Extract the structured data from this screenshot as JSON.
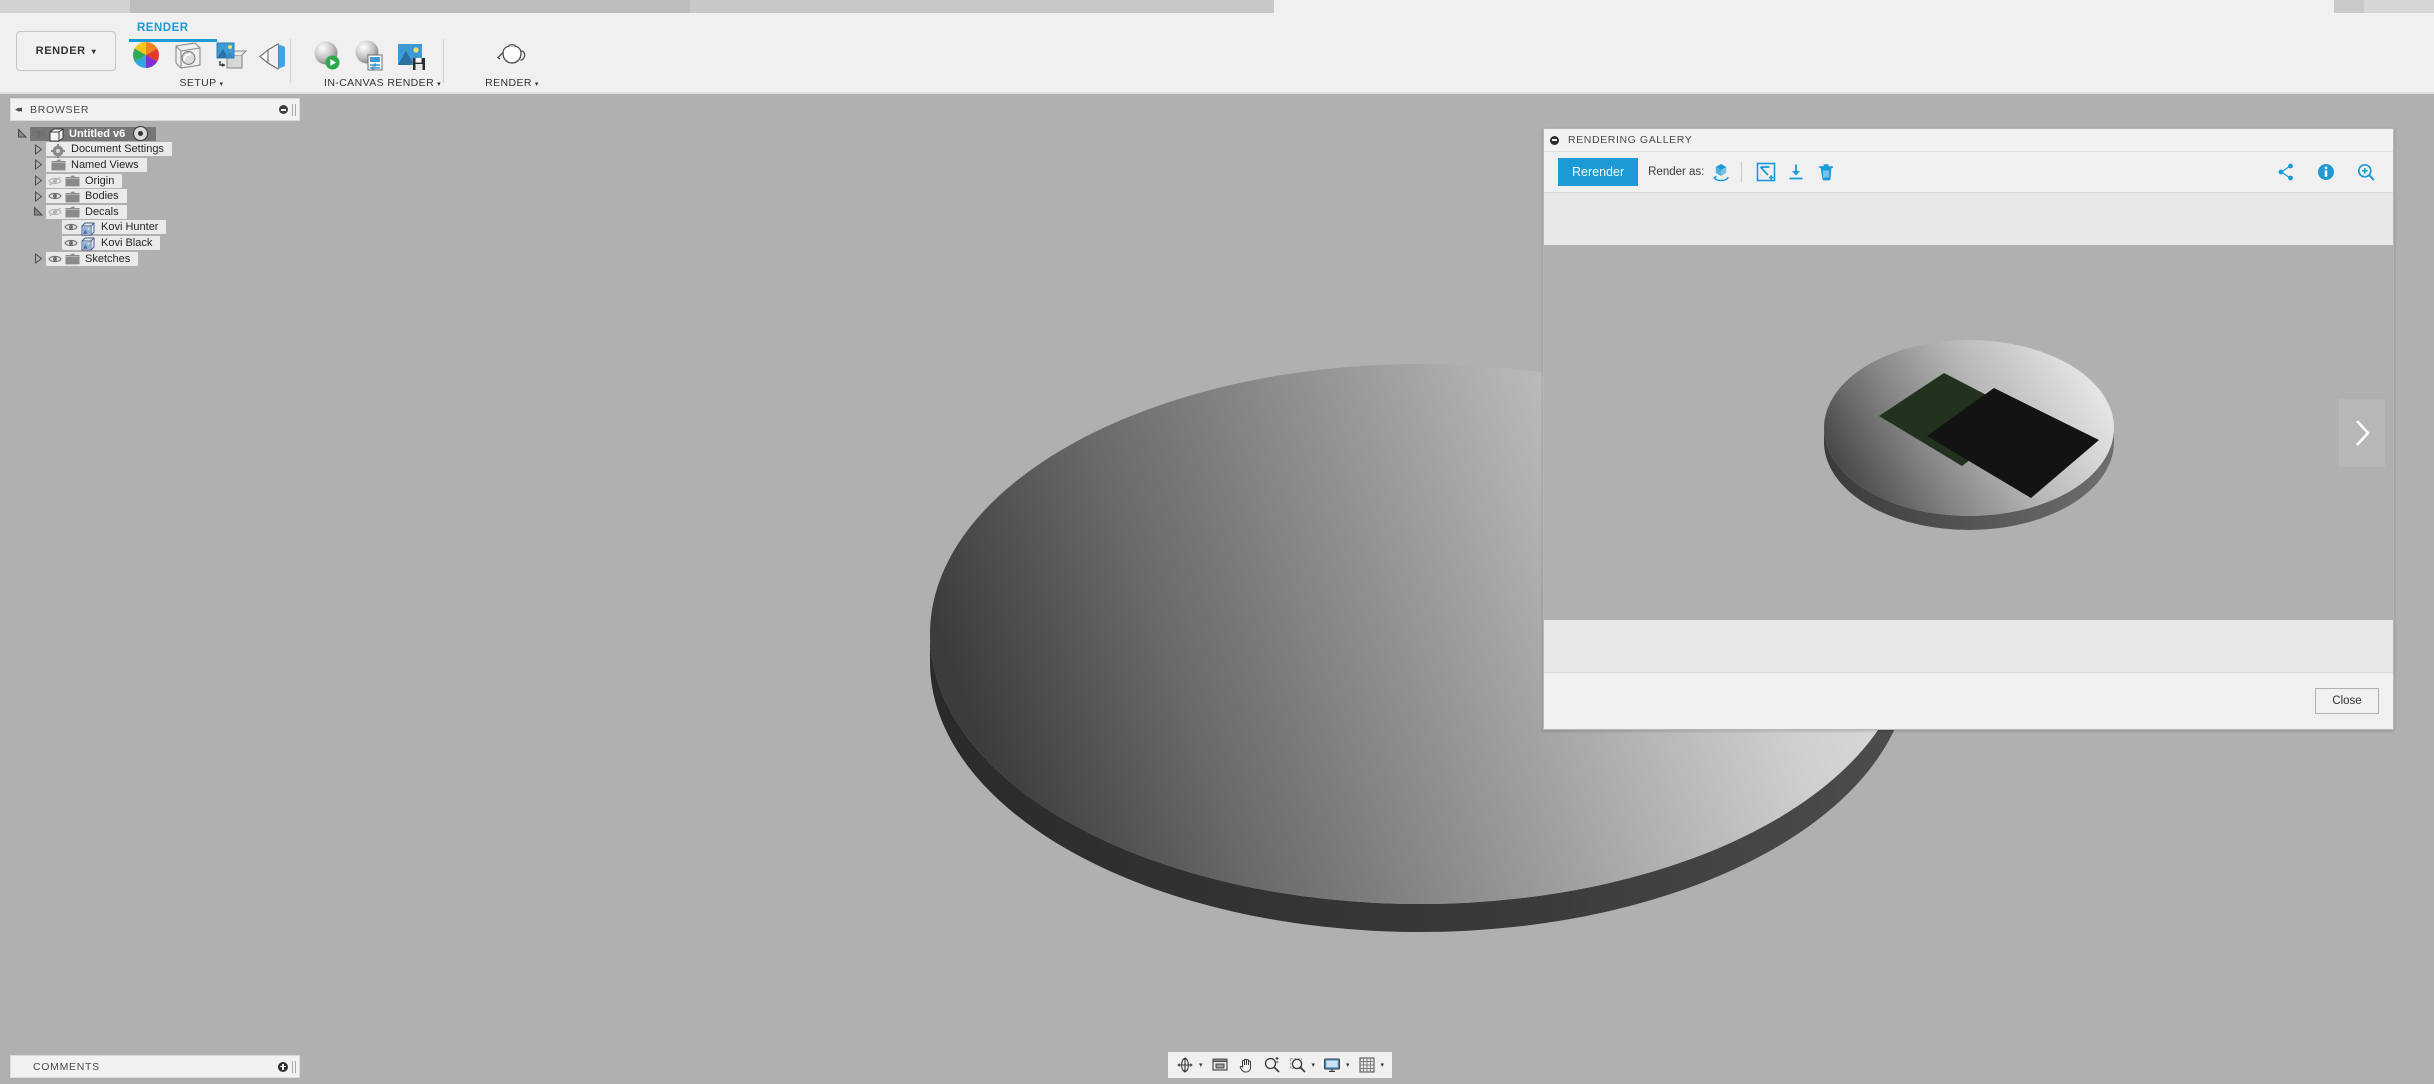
{
  "app": {
    "workspace_button": "RENDER",
    "workspace_caret": "▾",
    "active_tab": "RENDER"
  },
  "ribbon": {
    "groups": [
      {
        "label": "SETUP",
        "caret": "▾",
        "items": [
          {
            "name": "appearance-icon",
            "tooltip": "Appearance"
          },
          {
            "name": "scene-settings-icon",
            "tooltip": "Scene Settings"
          },
          {
            "name": "decal-icon",
            "tooltip": "Decal"
          },
          {
            "name": "texture-map-controls-icon",
            "tooltip": "Texture Map Controls"
          }
        ]
      },
      {
        "label": "IN-CANVAS RENDER",
        "caret": "▾",
        "items": [
          {
            "name": "in-canvas-render-icon",
            "tooltip": "In-canvas Render"
          },
          {
            "name": "in-canvas-render-settings-icon",
            "tooltip": "In-canvas Render Settings"
          },
          {
            "name": "capture-image-icon",
            "tooltip": "Capture Image"
          }
        ]
      },
      {
        "label": "RENDER",
        "caret": "▾",
        "items": [
          {
            "name": "render-teapot-icon",
            "tooltip": "Render"
          }
        ]
      }
    ]
  },
  "browser": {
    "title": "BROWSER",
    "collapse_glyph": "◂◂",
    "tree": [
      {
        "label": "Untitled v6",
        "indent": 0,
        "twist": "open",
        "icon": "component-icon",
        "eye": "visible",
        "selected": true,
        "radio": true
      },
      {
        "label": "Document Settings",
        "indent": 1,
        "twist": "closed",
        "icon": "gear-icon",
        "eye": "none",
        "selected": false,
        "radio": false
      },
      {
        "label": "Named Views",
        "indent": 1,
        "twist": "closed",
        "icon": "folder-icon",
        "eye": "none",
        "selected": false,
        "radio": false
      },
      {
        "label": "Origin",
        "indent": 1,
        "twist": "closed",
        "icon": "folder-icon",
        "eye": "hidden",
        "selected": false,
        "radio": false
      },
      {
        "label": "Bodies",
        "indent": 1,
        "twist": "closed",
        "icon": "folder-icon",
        "eye": "visible",
        "selected": false,
        "radio": false
      },
      {
        "label": "Decals",
        "indent": 1,
        "twist": "open",
        "icon": "folder-icon",
        "eye": "hidden",
        "selected": false,
        "radio": false
      },
      {
        "label": "Kovi Hunter",
        "indent": 2,
        "twist": "none",
        "icon": "decal-image-icon",
        "eye": "visible",
        "selected": false,
        "radio": false
      },
      {
        "label": "Kovi Black",
        "indent": 2,
        "twist": "none",
        "icon": "decal-image-icon",
        "eye": "visible",
        "selected": false,
        "radio": false
      },
      {
        "label": "Sketches",
        "indent": 1,
        "twist": "closed",
        "icon": "folder-icon",
        "eye": "visible",
        "selected": false,
        "radio": false
      }
    ]
  },
  "comments": {
    "title": "COMMENTS"
  },
  "navbar": {
    "items": [
      {
        "name": "orbit-icon",
        "caret": true
      },
      {
        "name": "look-at-icon",
        "caret": false
      },
      {
        "name": "pan-icon",
        "caret": false
      },
      {
        "name": "zoom-icon",
        "caret": false
      },
      {
        "name": "fit-icon",
        "caret": true
      },
      {
        "name": "display-settings-icon",
        "caret": true
      },
      {
        "name": "grid-snaps-icon",
        "caret": true
      }
    ]
  },
  "gallery": {
    "title": "RENDERING GALLERY",
    "rerender_label": "Rerender",
    "render_as_label": "Render as:",
    "tools": [
      {
        "name": "render-in-cloud-icon"
      },
      {
        "name": "image-resize-icon"
      },
      {
        "name": "download-icon"
      },
      {
        "name": "delete-icon"
      }
    ],
    "right_tools": [
      {
        "name": "share-icon"
      },
      {
        "name": "info-icon"
      },
      {
        "name": "zoom-in-icon"
      }
    ],
    "next_glyph": "›",
    "close_label": "Close"
  },
  "colors": {
    "accent": "#1b9ad6",
    "canvas_bg": "#b0b0b0",
    "panel_bg": "#f0f0f0",
    "dialog_strip": "#e8e8e8",
    "decal_green": "#22321f",
    "decal_black": "#131313"
  }
}
